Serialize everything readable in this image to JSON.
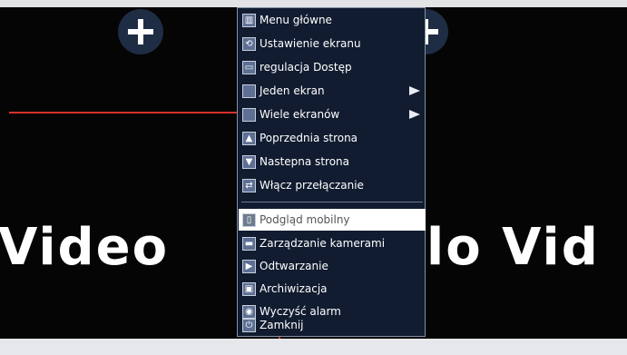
{
  "background": {
    "texts": [
      "Video",
      "lo Vid"
    ]
  },
  "menu": {
    "items": [
      {
        "label": "Menu główne",
        "icon": "home-icon",
        "glyph": "▥",
        "submenu": false
      },
      {
        "label": "Ustawienie ekranu",
        "icon": "screen-settings-icon",
        "glyph": "⟲",
        "submenu": false
      },
      {
        "label": "regulacja Dostęp",
        "icon": "access-icon",
        "glyph": "▭",
        "submenu": false
      },
      {
        "label": "Jeden ekran",
        "icon": "single-screen-icon",
        "glyph": "",
        "submenu": true
      },
      {
        "label": "Wiele ekranów",
        "icon": "multi-screen-icon",
        "glyph": "",
        "submenu": true
      },
      {
        "label": "Poprzednia strona",
        "icon": "arrow-up-icon",
        "glyph": "▲",
        "submenu": false
      },
      {
        "label": "Nastepna strona",
        "icon": "arrow-down-icon",
        "glyph": "▼",
        "submenu": false
      },
      {
        "label": "Włącz przełączanie",
        "icon": "switch-icon",
        "glyph": "⇄",
        "submenu": false
      },
      {
        "label": "Podgląd mobilny",
        "icon": "mobile-preview-icon",
        "glyph": "▯",
        "submenu": false,
        "selected": true
      },
      {
        "label": "Zarządzanie kamerami",
        "icon": "camera-management-icon",
        "glyph": "▬",
        "submenu": false
      },
      {
        "label": "Odtwarzanie",
        "icon": "playback-icon",
        "glyph": "▶",
        "submenu": false
      },
      {
        "label": "Archiwizacja",
        "icon": "archive-icon",
        "glyph": "▣",
        "submenu": false
      },
      {
        "label": "Wyczyść alarm",
        "icon": "clear-alarm-icon",
        "glyph": "◉",
        "submenu": false
      },
      {
        "label": "Zamknij",
        "icon": "power-icon",
        "glyph": "⏻",
        "submenu": false
      }
    ]
  },
  "colors": {
    "menu_bg": "#111c30",
    "grid_line": "#d8312a",
    "selected_bg": "#ffffff"
  }
}
